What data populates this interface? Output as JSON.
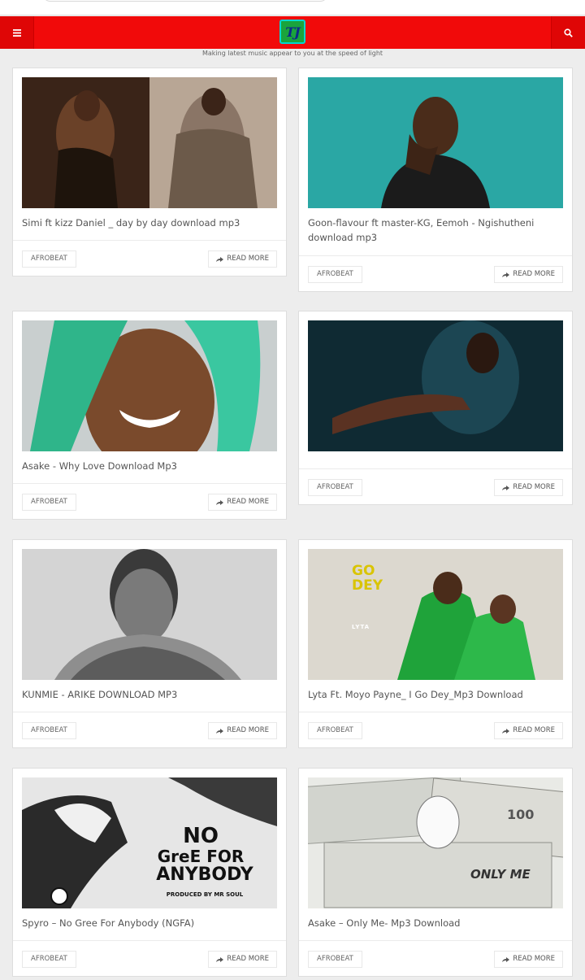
{
  "header": {
    "tagline": "Making latest music appear to you at the speed of light",
    "logo_text": "TJ",
    "menu_icon": "bars-icon",
    "search_icon": "search-icon"
  },
  "colors": {
    "navbar": "#f10a0a",
    "background": "#ededed"
  },
  "posts": [
    {
      "title": "Simi ft kizz Daniel _ day by day download mp3",
      "category": "AFROBEAT",
      "read_more": "READ MORE"
    },
    {
      "title": "Goon-flavour ft master-KG, Eemoh - Ngishutheni download mp3",
      "category": "AFROBEAT",
      "read_more": "READ MORE"
    },
    {
      "title": "Asake - Why Love Download Mp3",
      "category": "AFROBEAT",
      "read_more": "READ MORE"
    },
    {
      "title": "",
      "category": "AFROBEAT",
      "read_more": "READ MORE"
    },
    {
      "title": "KUNMIE - ARIKE DOWNLOAD MP3",
      "category": "AFROBEAT",
      "read_more": "READ MORE"
    },
    {
      "title": "Lyta Ft. Moyo Payne_ I Go Dey_Mp3 Download",
      "category": "AFROBEAT",
      "read_more": "READ MORE"
    },
    {
      "title": "Spyro – No Gree For Anybody (NGFA)",
      "category": "AFROBEAT",
      "read_more": "READ MORE"
    },
    {
      "title": "Asake – Only Me- Mp3 Download",
      "category": "AFROBEAT",
      "read_more": "READ MORE"
    }
  ],
  "artwork_text": {
    "lyta_cover": "GO DEY",
    "lyta_name": "LYTA",
    "spyro_line1": "NO",
    "spyro_line2": "GreE FOR",
    "spyro_line3": "ANYBODY",
    "spyro_producer": "PRODUCED BY MR SOUL",
    "asake_cover": "ONLY ME",
    "asake_bill": "100"
  }
}
